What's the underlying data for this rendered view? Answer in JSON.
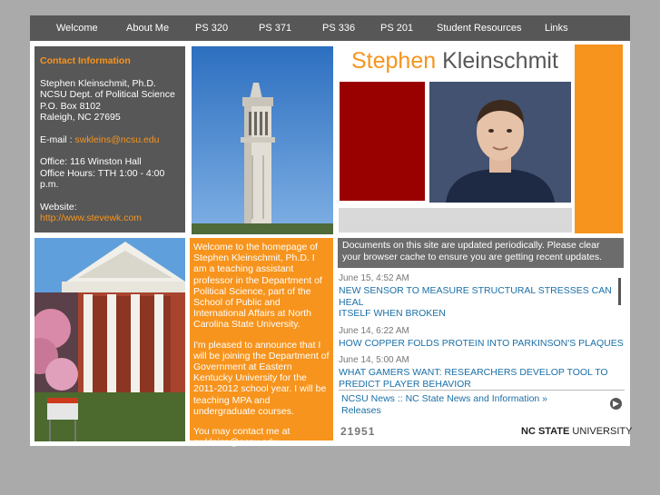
{
  "nav": {
    "items": [
      {
        "label": "Welcome"
      },
      {
        "label": "About Me"
      },
      {
        "label": "PS 320"
      },
      {
        "label": "PS 371"
      },
      {
        "label": "PS 336"
      },
      {
        "label": "PS 201"
      },
      {
        "label": "Student Resources"
      },
      {
        "label": "Links"
      }
    ]
  },
  "header": {
    "first_name": "Stephen",
    "last_name": "Kleinschmit"
  },
  "contact": {
    "heading": "Contact Information",
    "name": "Stephen Kleinschmit, Ph.D.",
    "dept": "NCSU Dept. of Political Science",
    "box": "P.O. Box 8102",
    "city": "Raleigh, NC 27695",
    "email_label": "E-mail : ",
    "email": "swkleins@ncsu.edu",
    "office": "Office: 116 Winston Hall",
    "hours": "Office Hours: TTH 1:00 - 4:00 p.m.",
    "website_label": "Website:",
    "website": "http://www.stevewk.com"
  },
  "welcome": {
    "p1": "Welcome to the homepage of Stephen Kleinschmit, Ph.D. I am a teaching assistant professor in the Department of Political Science, part of the School of Public and International Affairs at North Carolina State University.",
    "p2": "I'm pleased to announce that I will be joining the Department of Government at Eastern Kentucky University for the 2011-2012 school year. I will be teaching MPA and undergraduate courses.",
    "p3": "You may contact me at swkleins@ncsu.edu"
  },
  "notice": "Documents on this site are updated periodically. Please clear your browser cache to ensure you are getting recent updates.",
  "news": {
    "items": [
      {
        "date": "June 15, 4:52 AM",
        "title": "New sensor to measure structural stresses can heal\nitself when broken"
      },
      {
        "date": "June 14, 6:22 AM",
        "title": "How copper folds protein into Parkinson's plaques"
      },
      {
        "date": "June 14, 5:00 AM",
        "title": "What gamers want: Researchers develop tool to\npredict player behavior"
      }
    ],
    "feed_label": "NCSU News :: NC State News and Information » Releases"
  },
  "footer": {
    "counter": "21951",
    "ncsu_bold": "NC STATE",
    "ncsu_rest": " UNIVERSITY"
  },
  "colors": {
    "accent_orange": "#f7941d",
    "dark_gray": "#575757",
    "maroon": "#990000",
    "link_blue": "#1a6fa6"
  }
}
